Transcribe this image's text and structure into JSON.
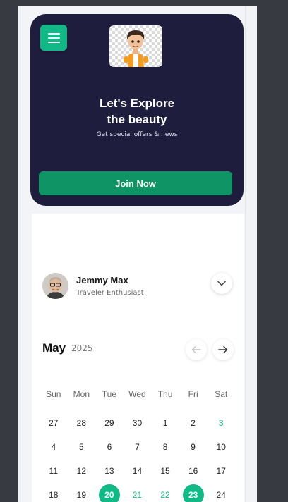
{
  "colors": {
    "accent": "#12b886",
    "join_button": "#0f9465",
    "hero_bg": "#1e1d3e"
  },
  "hero": {
    "menu_icon": "hamburger-menu-icon",
    "title_line1": "Let's Explore",
    "title_line2": "the beauty",
    "subtitle": "Get special offers & news",
    "cta_label": "Join Now"
  },
  "profile": {
    "name": "Jemmy Max",
    "role": "Traveler Enthusiast",
    "toggle_icon": "chevron-down-icon"
  },
  "calendar": {
    "month": "May",
    "year": "2025",
    "prev_icon": "arrow-left-icon",
    "next_icon": "arrow-right-icon",
    "weekdays": [
      "Sun",
      "Mon",
      "Tue",
      "Wed",
      "Thu",
      "Fri",
      "Sat"
    ],
    "days": [
      {
        "label": "27",
        "state": "normal"
      },
      {
        "label": "28",
        "state": "normal"
      },
      {
        "label": "29",
        "state": "normal"
      },
      {
        "label": "30",
        "state": "normal"
      },
      {
        "label": "1",
        "state": "normal"
      },
      {
        "label": "2",
        "state": "normal"
      },
      {
        "label": "3",
        "state": "accent"
      },
      {
        "label": "4",
        "state": "normal"
      },
      {
        "label": "5",
        "state": "normal"
      },
      {
        "label": "6",
        "state": "normal"
      },
      {
        "label": "7",
        "state": "normal"
      },
      {
        "label": "8",
        "state": "normal"
      },
      {
        "label": "9",
        "state": "normal"
      },
      {
        "label": "10",
        "state": "normal"
      },
      {
        "label": "11",
        "state": "normal"
      },
      {
        "label": "12",
        "state": "normal"
      },
      {
        "label": "13",
        "state": "normal"
      },
      {
        "label": "14",
        "state": "normal"
      },
      {
        "label": "15",
        "state": "normal"
      },
      {
        "label": "16",
        "state": "normal"
      },
      {
        "label": "17",
        "state": "normal"
      },
      {
        "label": "18",
        "state": "normal"
      },
      {
        "label": "19",
        "state": "normal"
      },
      {
        "label": "20",
        "state": "selected"
      },
      {
        "label": "21",
        "state": "accent"
      },
      {
        "label": "22",
        "state": "accent"
      },
      {
        "label": "23",
        "state": "selected"
      },
      {
        "label": "24",
        "state": "normal"
      }
    ]
  }
}
